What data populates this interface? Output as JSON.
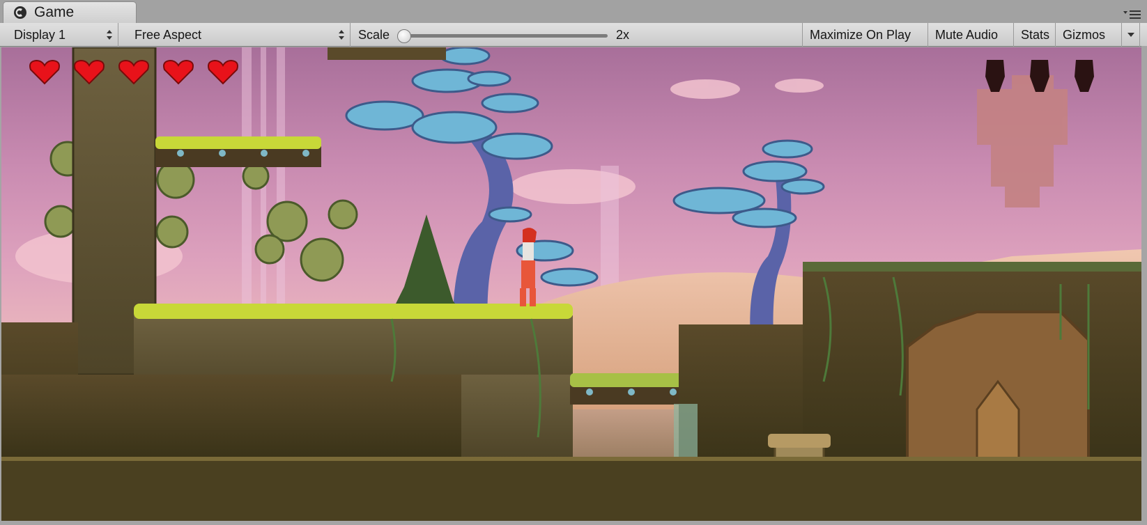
{
  "window": {
    "tab_title": "Game",
    "tab_icon": "unity-logo-icon",
    "panel_menu_icon": "panel-menu-icon"
  },
  "toolbar": {
    "display_select": {
      "value": "Display 1"
    },
    "aspect_select": {
      "value": "Free Aspect"
    },
    "scale": {
      "label": "Scale",
      "value_text": "2x",
      "value": 0.0
    },
    "maximize_on_play": "Maximize On Play",
    "mute_audio": "Mute Audio",
    "stats": "Stats",
    "gizmos": "Gizmos"
  },
  "game": {
    "hud": {
      "health_hearts": 5,
      "collectibles_slots": 3
    },
    "colors": {
      "heart": "#e8121a",
      "grass": "#c8d838",
      "sky_top": "#a86f9a",
      "sky_mid": "#dda1bd",
      "mushroom_tree": "#6fb6d6"
    }
  }
}
